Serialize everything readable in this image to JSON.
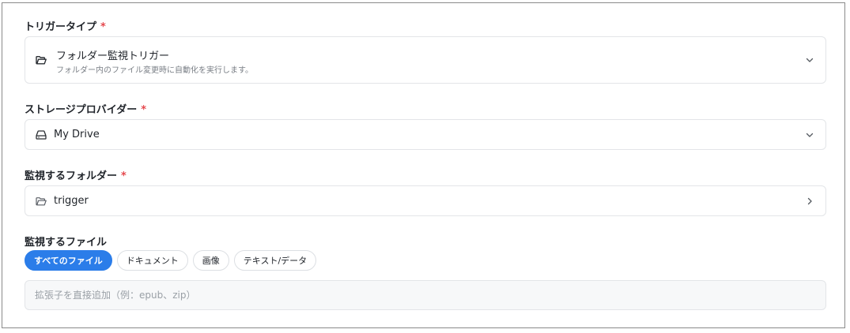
{
  "trigger_type": {
    "label": "トリガータイプ",
    "required_mark": "*",
    "selected_title": "フォルダー監視トリガー",
    "selected_description": "フォルダー内のファイル変更時に自動化を実行します。",
    "icon": "folder-open-icon"
  },
  "storage_provider": {
    "label": "ストレージプロバイダー",
    "required_mark": "*",
    "selected": "My Drive",
    "icon": "drive-icon"
  },
  "watch_folder": {
    "label": "監視するフォルダー",
    "required_mark": "*",
    "selected": "trigger",
    "icon": "folder-icon"
  },
  "watch_files": {
    "label": "監視するファイル",
    "filters": [
      {
        "label": "すべてのファイル",
        "active": true
      },
      {
        "label": "ドキュメント",
        "active": false
      },
      {
        "label": "画像",
        "active": false
      },
      {
        "label": "テキスト/データ",
        "active": false
      }
    ],
    "extension_placeholder": "拡張子を直接追加（例：epub、zip）"
  },
  "colors": {
    "accent": "#2b7de9",
    "required": "#e5484d",
    "border": "#e3e5e8"
  }
}
